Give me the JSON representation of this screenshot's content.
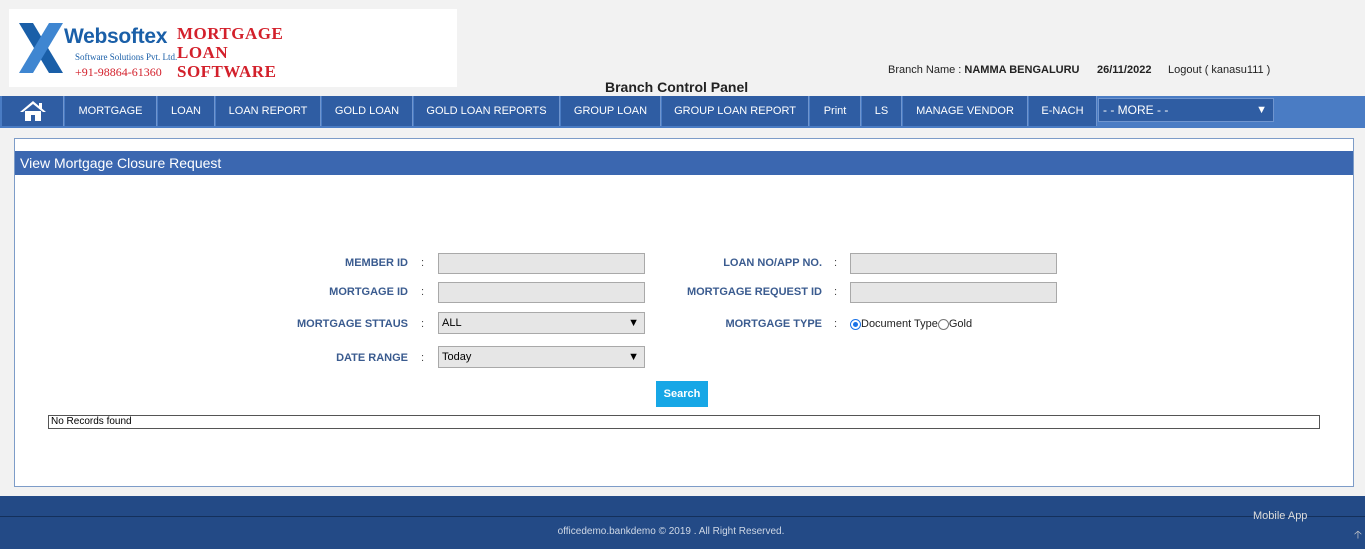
{
  "header": {
    "logo_name": "Websoftex",
    "logo_tagline": "Software Solutions Pvt. Ltd.",
    "logo_phone": "+91-98864-61360",
    "product_line1": "MORTGAGE",
    "product_line2": "LOAN",
    "product_line3": "SOFTWARE",
    "panel_title": "Branch Control Panel",
    "branch_label": "Branch Name : ",
    "branch_value": "NAMMA BENGALURU",
    "date": "26/11/2022",
    "logout": "Logout ( kanasu111 )"
  },
  "nav": {
    "items": [
      "MORTGAGE",
      "LOAN",
      "LOAN REPORT",
      "GOLD LOAN",
      "GOLD LOAN REPORTS",
      "GROUP LOAN",
      "GROUP LOAN REPORT",
      "Print",
      "LS",
      "MANAGE VENDOR",
      "E-NACH"
    ],
    "more": "- - MORE - -"
  },
  "panel": {
    "title": "View Mortgage Closure Request",
    "colon": ":",
    "member_id_label": "MEMBER ID",
    "loan_no_label": "LOAN NO/APP NO.",
    "mortgage_id_label": "MORTGAGE ID",
    "mortgage_request_id_label": "MORTGAGE REQUEST ID",
    "mortgage_status_label": "MORTGAGE STTAUS",
    "mortgage_status_value": "ALL",
    "mortgage_type_label": "MORTGAGE TYPE",
    "mortgage_type_options": [
      "Document Type",
      "Gold"
    ],
    "date_range_label": "DATE RANGE",
    "date_range_value": "Today",
    "search_button": "Search",
    "results_text": "No Records found"
  },
  "footer": {
    "copyright": "officedemo.bankdemo © 2019 . All Right Reserved.",
    "mobile_app": "Mobile App"
  }
}
